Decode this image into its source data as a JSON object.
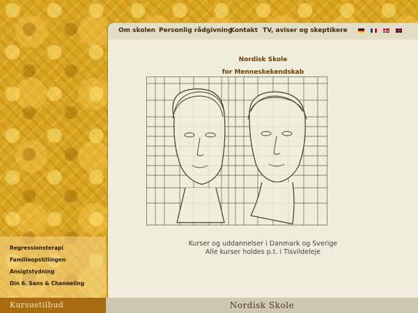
{
  "nav": {
    "items": [
      "Om skolen",
      "Personlig rådgivning",
      "Kontakt",
      "TV, aviser og skeptikere"
    ],
    "flags": [
      "german-flag-icon",
      "french-flag-icon",
      "danish-flag-icon",
      "uk-flag-icon"
    ]
  },
  "main": {
    "title_line1": "Nordisk Skole",
    "title_line2": "for Menneskekendskab",
    "caption_line1": "Kurser og uddannelser i Danmark og Sverige",
    "caption_line2": "Alle kurser holdes p.t. i Tisvildeleje"
  },
  "sidebar": {
    "items": [
      "Regressionsterapi",
      "Familieopstillingen",
      "Ansigtstydning",
      "Din 6. Sans & Channeling"
    ]
  },
  "footer": {
    "left_label": "Kursustilbud",
    "right_label": "Nordisk Skole"
  },
  "colors": {
    "background_gold": "#d9a520",
    "content_bg": "#f1eddd",
    "title_brown": "#6b3d00",
    "footer_left": "#a86b10",
    "footer_right": "#cfc8b0"
  }
}
